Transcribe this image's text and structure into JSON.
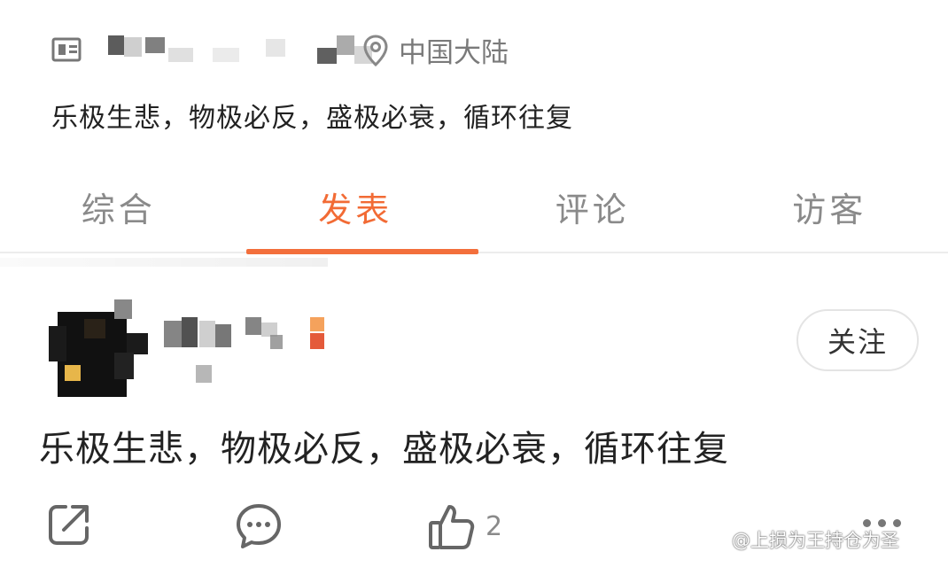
{
  "profile": {
    "location": "中国大陆",
    "bio": "乐极生悲，物极必反，盛极必衰，循环往复"
  },
  "tabs": [
    {
      "label": "综合",
      "active": false
    },
    {
      "label": "发表",
      "active": true
    },
    {
      "label": "评论",
      "active": false
    },
    {
      "label": "访客",
      "active": false
    }
  ],
  "post": {
    "follow_label": "关注",
    "text": "乐极生悲，物极必反，盛极必衰，循环往复",
    "like_count": "2"
  },
  "icons": {
    "id": "id-card-icon",
    "location": "location-pin-icon",
    "share": "share-icon",
    "comment": "comment-icon",
    "like": "thumbs-up-icon",
    "more": "more-dots-icon"
  },
  "colors": {
    "accent": "#f26b35",
    "muted": "#8a8a8a"
  },
  "watermark": "@上损为王持仓为圣"
}
